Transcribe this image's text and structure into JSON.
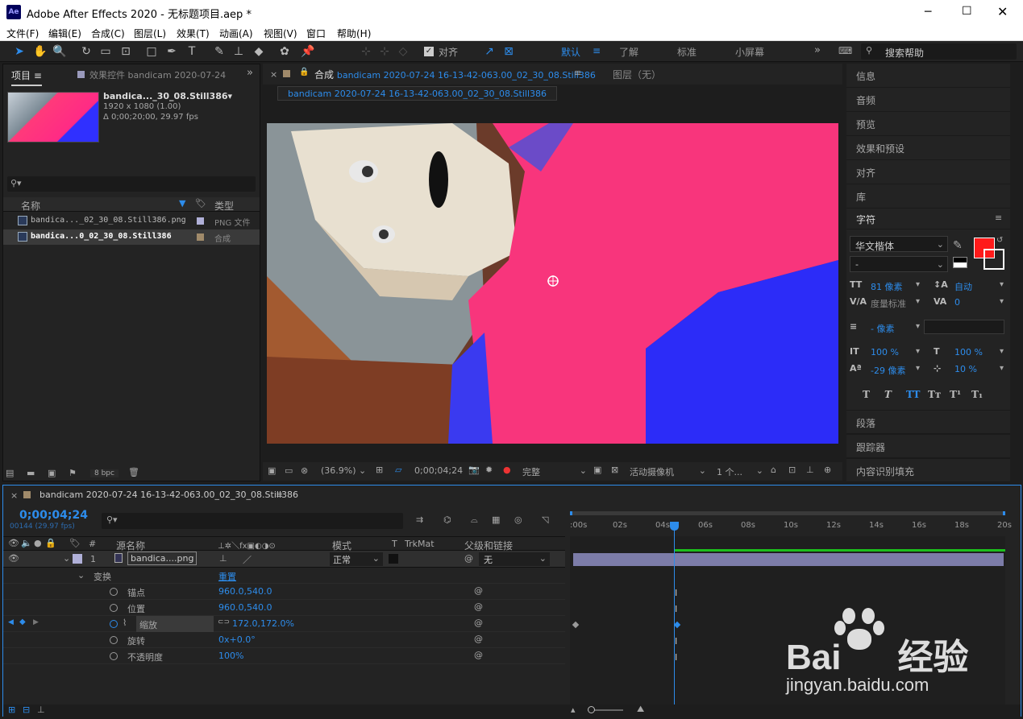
{
  "window": {
    "title": "Adobe After Effects 2020 - 无标题项目.aep *",
    "logo": "Ae"
  },
  "menu": [
    "文件(F)",
    "编辑(E)",
    "合成(C)",
    "图层(L)",
    "效果(T)",
    "动画(A)",
    "视图(V)",
    "窗口",
    "帮助(H)"
  ],
  "toolbar": {
    "align_label": "对齐",
    "workspaces": [
      "默认",
      "了解",
      "标准",
      "小屏幕"
    ],
    "search_placeholder": "搜索帮助"
  },
  "project": {
    "tab_project": "项目",
    "tab_effects": "效果控件 bandicam 2020-07-24",
    "thumb_name": "bandica..._30_08.Still386▾",
    "thumb_size": "1920 x 1080 (1.00)",
    "thumb_duration": "Δ 0;00;20;00, 29.97 fps",
    "col_name": "名称",
    "col_type": "类型",
    "items": [
      {
        "name": "bandica..._02_30_08.Still386.png",
        "type": "PNG 文件"
      },
      {
        "name": "bandica...0_02_30_08.Still386",
        "type": "合成"
      }
    ],
    "bpc": "8 bpc"
  },
  "composition": {
    "tab_label": "合成",
    "comp_name": "bandicam 2020-07-24 16-13-42-063.00_02_30_08.Still386",
    "layer_tab": "图层（无）",
    "zoom": "(36.9%)",
    "timecode": "0;00;04;24",
    "quality": "完整",
    "camera": "活动摄像机",
    "views": "1 个..."
  },
  "right_panel": {
    "items": [
      "信息",
      "音频",
      "预览",
      "效果和预设",
      "对齐",
      "库"
    ],
    "char_title": "字符",
    "font": "华文楷体",
    "style": "-",
    "size": "81 像素",
    "leading": "自动",
    "kerning": "度量标准",
    "tracking": "0",
    "stroke": "- 像素",
    "vscale": "100 %",
    "hscale": "100 %",
    "baseline": "-29 像素",
    "tsume": "10 %",
    "styles": [
      "T",
      "T",
      "TT",
      "Tт",
      "T¹",
      "T₁"
    ],
    "bottom_items": [
      "段落",
      "跟踪器",
      "内容识别填充"
    ],
    "fill_color": "#ff1a1a"
  },
  "timeline": {
    "tab": "bandicam 2020-07-24 16-13-42-063.00_02_30_08.Still386",
    "timecode": "0;00;04;24",
    "frames": "00144 (29.97 fps)",
    "cols": {
      "source": "源名称",
      "mode": "模式",
      "t": "T",
      "trkmat": "TrkMat",
      "parent": "父级和链接"
    },
    "layer": {
      "num": "1",
      "name": "bandica....png",
      "mode": "正常",
      "parent": "无"
    },
    "transform": {
      "label": "变换",
      "reset": "重置"
    },
    "props": [
      {
        "name": "锚点",
        "value": "960.0,540.0"
      },
      {
        "name": "位置",
        "value": "960.0,540.0"
      },
      {
        "name": "缩放",
        "value": "172.0,172.0%"
      },
      {
        "name": "旋转",
        "value": "0x+0.0°"
      },
      {
        "name": "不透明度",
        "value": "100%"
      }
    ],
    "ticks": [
      ":00s",
      "02s",
      "04s",
      "06s",
      "08s",
      "10s",
      "12s",
      "14s",
      "16s",
      "18s",
      "20s"
    ]
  },
  "watermark": {
    "brand": "Bai",
    "suffix": "经验",
    "url": "jingyan.baidu.com"
  }
}
